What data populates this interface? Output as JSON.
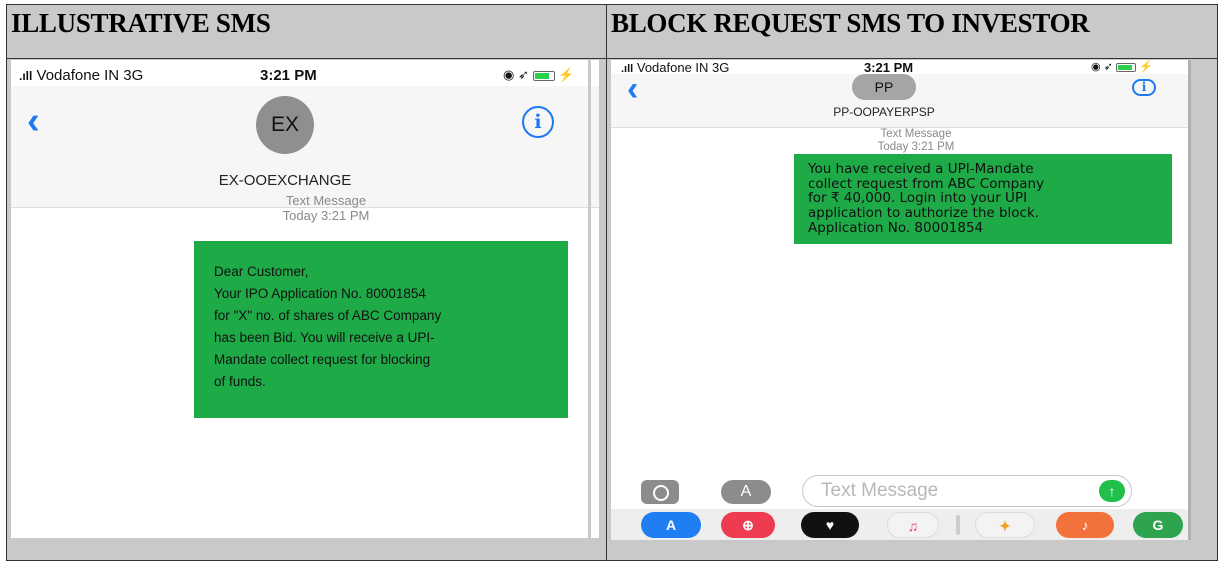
{
  "table": {
    "left_title": "ILLUSTRATIVE SMS",
    "right_title": "BLOCK REQUEST SMS TO INVESTOR"
  },
  "phone1": {
    "status": {
      "carrier": "Vodafone IN  3G",
      "time": "3:21 PM"
    },
    "avatar_initials": "EX",
    "sender": "EX-OOEXCHANGE",
    "meta_line1": "Text Message",
    "meta_line2": "Today 3:21 PM",
    "message_lines": [
      "Dear Customer,",
      "Your IPO Application No. 80001854",
      "for \"X\" no. of shares of ABC Company",
      "has been Bid. You will receive a UPI-",
      "Mandate collect request for blocking",
      "of funds."
    ],
    "bubble_color": "#1faa48"
  },
  "phone2": {
    "status": {
      "carrier": "Vodafone IN  3G",
      "time": "3:21 PM"
    },
    "avatar_initials": "PP",
    "sender": "PP-OOPAYERPSP",
    "meta_line1": "Text Message",
    "meta_line2": "Today 3:21 PM",
    "message_lines": [
      "You have received a UPI-Mandate",
      "collect request from ABC Company",
      "for ₹ 40,000. Login into your UPI",
      "application to authorize the block.",
      "Application No. 80001854"
    ],
    "input_placeholder": "Text Message",
    "dock_icons": [
      "app-store-icon",
      "search-web-icon",
      "heart-icon",
      "music-icon",
      "photos-icon",
      "music-app-icon",
      "google-icon"
    ]
  }
}
